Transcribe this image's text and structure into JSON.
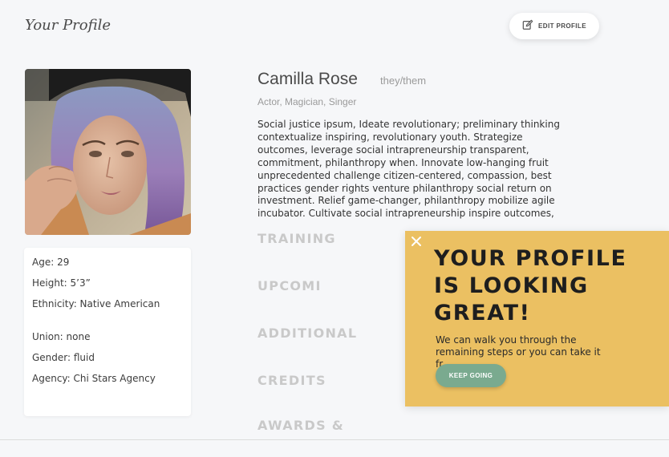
{
  "header": {
    "title": "Your Profile",
    "edit_label": "EDIT PROFILE"
  },
  "profile": {
    "name": "Camilla Rose",
    "pronouns": "they/them",
    "roles": "Actor, Magician, Singer",
    "bio": "Social justice ipsum, Ideate revolutionary; preliminary thinking contextualize inspiring, revolutionary youth. Strategize outcomes, leverage social intrapreneurship transparent, commitment, philanthropy when. Innovate low-hanging fruit unprecedented challenge citizen-centered, compassion, best practices gender rights venture philanthropy social return on investment. Relief game-changer, philanthropy mobilize agile incubator. Cultivate social intrapreneurship inspire outcomes,"
  },
  "info": [
    "Age: 29",
    "Height: 5’3”",
    "Ethnicity: Native American",
    "Union: none",
    "Gender: fluid",
    "Agency: Chi Stars Agency"
  ],
  "sections": [
    "TRAINING",
    "UPCOMI",
    "ADDITIONAL",
    "CREDITS",
    "AWARDS &"
  ],
  "popup": {
    "headline_lines": [
      "YOUR PROFILE",
      "IS LOOKING",
      "GREAT!"
    ],
    "message": "We can walk you through the remaining steps or you can take it fr…",
    "button_label": "KEEP GOING"
  },
  "colors": {
    "popup_bg": "#ebc062",
    "button_green": "#7aaa8f",
    "section_gray": "#c9c9c9"
  },
  "icons": {
    "edit": "edit-icon",
    "close": "close-icon"
  }
}
